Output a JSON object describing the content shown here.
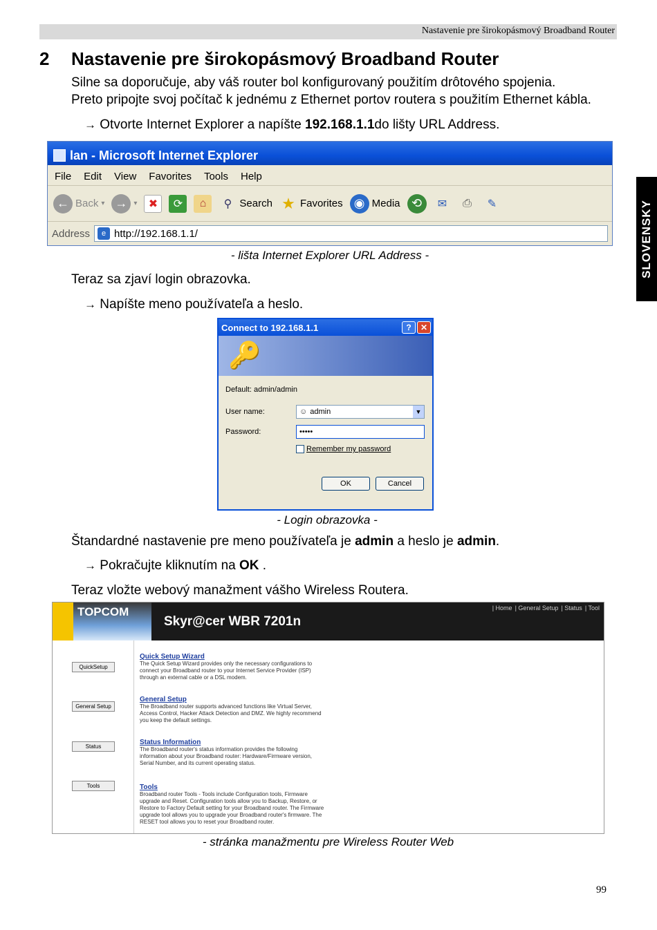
{
  "header": {
    "running_title": "Nastavenie pre širokopásmový Broadband Router"
  },
  "section": {
    "number": "2",
    "title": "Nastavenie pre širokopásmový Broadband Router"
  },
  "side_tab": "SLOVENSKY",
  "intro": {
    "line1": "Silne sa doporučuje, aby váš router bol konfigurovaný použitím drôtového spojenia.",
    "line2": "Preto pripojte svoj počítač k jednému z Ethernet portov routera s použitím Ethernet kábla."
  },
  "step1": {
    "arrow": "→",
    "pre": "Otvorte Internet Explorer a napíšte ",
    "bold": "192.168.1.1",
    "post": "do lišty URL Address."
  },
  "ie": {
    "title": "lan - Microsoft Internet Explorer",
    "menu": [
      "File",
      "Edit",
      "View",
      "Favorites",
      "Tools",
      "Help"
    ],
    "back": "Back",
    "search": "Search",
    "favorites": "Favorites",
    "media": "Media",
    "address_label": "Address",
    "address_value": "http://192.168.1.1/"
  },
  "caption1": "- lišta Internet Explorer URL Address -",
  "para2": "Teraz sa zjaví login obrazovka.",
  "step2": {
    "arrow": "→",
    "text": "Napíšte meno používateľa a heslo."
  },
  "login": {
    "title": "Connect to 192.168.1.1",
    "default": "Default: admin/admin",
    "user_label": "User name:",
    "user_value": "admin",
    "pass_label": "Password:",
    "pass_value": "•••••",
    "remember": "Remember my password",
    "ok": "OK",
    "cancel": "Cancel"
  },
  "caption2": "- Login obrazovka -",
  "para3": {
    "pre": "Štandardné nastavenie pre meno používateľa je ",
    "b1": "admin",
    "mid": " a heslo je ",
    "b2": "admin",
    "post": "."
  },
  "step3": {
    "arrow": "→",
    "pre": "Pokračujte kliknutím na ",
    "bold": "OK",
    "post": " ."
  },
  "para4": "Teraz vložte webový manažment vášho Wireless Routera.",
  "router": {
    "logo": "TOPCOM",
    "product": "Skyr@cer WBR 7201n",
    "links": [
      "| Home",
      "| General Setup",
      "| Status",
      "| Tool"
    ],
    "buttons": [
      "QuickSetup",
      "General Setup",
      "Status",
      "Tools"
    ],
    "sections": [
      {
        "title": "Quick Setup Wizard",
        "desc": "The Quick Setup Wizard provides only the necessary configurations to connect your Broadband router to your Internet Service Provider (ISP) through an external cable or a DSL modem."
      },
      {
        "title": "General Setup",
        "desc": "The Broadband router supports advanced functions like Virtual Server, Access Control, Hacker Attack Detection and DMZ. We highly recommend you keep the default settings."
      },
      {
        "title": "Status Information",
        "desc": "The Broadband router's status information provides the following information about your Broadband router: Hardware/Firmware version, Serial Number, and its current operating status."
      },
      {
        "title": "Tools",
        "desc": "Broadband router Tools - Tools include Configuration tools, Firmware upgrade and Reset. Configuration tools allow you to Backup, Restore, or Restore to Factory Default setting for your Broadband router. The Firmware upgrade tool allows you to upgrade your Broadband router's firmware. The RESET tool allows you to reset your Broadband router."
      }
    ]
  },
  "caption3": "- stránka manažmentu pre Wireless Router Web",
  "page_number": "99"
}
